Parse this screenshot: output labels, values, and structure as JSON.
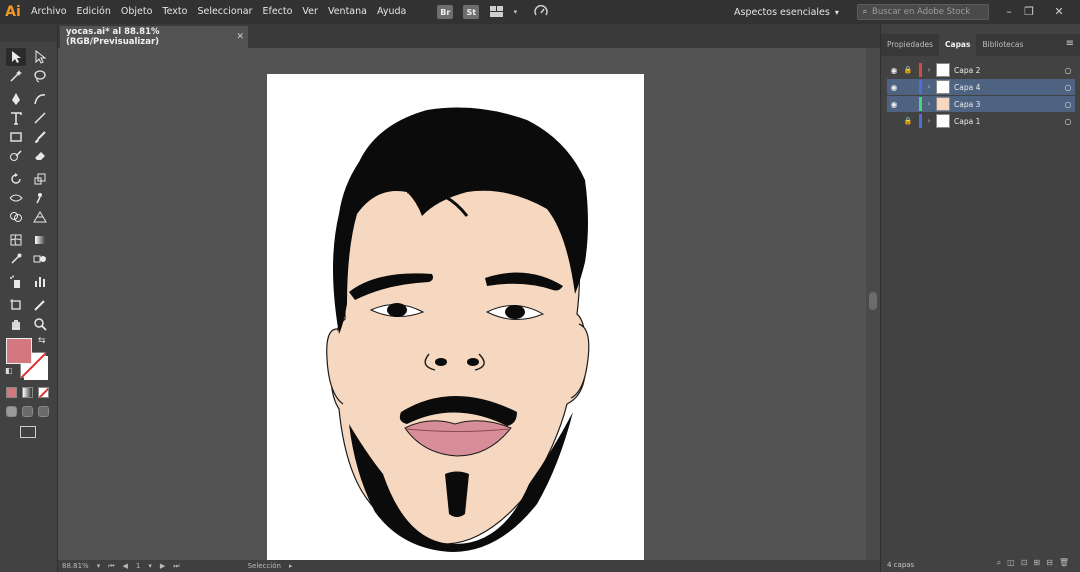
{
  "app": {
    "logo": "Ai"
  },
  "menu": [
    "Archivo",
    "Edición",
    "Objeto",
    "Texto",
    "Seleccionar",
    "Efecto",
    "Ver",
    "Ventana",
    "Ayuda"
  ],
  "menubar_icons": {
    "bridge": "Br",
    "stock": "St"
  },
  "workspace": {
    "label": "Aspectos esenciales"
  },
  "stock_search": {
    "placeholder": "Buscar en Adobe Stock"
  },
  "document": {
    "tab_title": "yocas.ai* al 88.81% (RGB/Previsualizar)"
  },
  "status": {
    "zoom": "88.81%",
    "artboard": "1",
    "tool": "Selección"
  },
  "panel": {
    "tabs": [
      "Propiedades",
      "Capas",
      "Bibliotecas"
    ],
    "active_tab": "Capas",
    "layers": [
      {
        "name": "Capa 2",
        "visible": true,
        "locked": true,
        "color": "#d24b4b",
        "selected": false
      },
      {
        "name": "Capa 4",
        "visible": true,
        "locked": false,
        "color": "#4b6fd2",
        "selected": true
      },
      {
        "name": "Capa 3",
        "visible": true,
        "locked": false,
        "color": "#4fd27a",
        "selected": true
      },
      {
        "name": "Capa 1",
        "visible": false,
        "locked": true,
        "color": "#4b6fd2",
        "selected": false
      }
    ],
    "layer_count": "4 capas"
  },
  "colors": {
    "fill": "#d3787f",
    "skin": "#f6d8c0",
    "lips": "#d88e98",
    "hair": "#0b0b0b",
    "accent_selected": "#4d6381"
  }
}
